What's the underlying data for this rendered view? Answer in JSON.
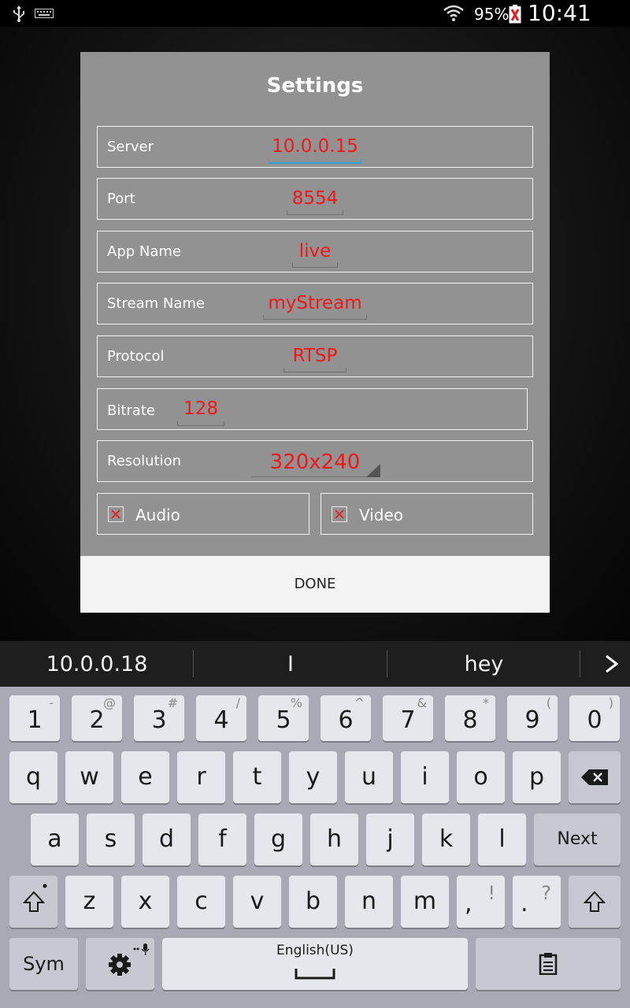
{
  "status_bar": {
    "battery": "95%",
    "time": "10:41 AM"
  },
  "dialog": {
    "title": "Settings",
    "fields": [
      {
        "label": "Server",
        "value": "10.0.0.15"
      },
      {
        "label": "Port",
        "value": "8554"
      },
      {
        "label": "App Name",
        "value": "live"
      },
      {
        "label": "Stream Name",
        "value": "myStream"
      },
      {
        "label": "Protocol",
        "value": "RTSP"
      },
      {
        "label": "Bitrate",
        "value": "128"
      },
      {
        "label": "Resolution",
        "value": "320x240"
      }
    ],
    "checkboxes": [
      {
        "label": "Audio",
        "checked": true
      },
      {
        "label": "Video",
        "checked": true
      }
    ],
    "done_label": "DONE"
  },
  "suggestions": [
    "10.0.0.18",
    "I",
    "hey"
  ],
  "keyboard": {
    "number_row": [
      {
        "key": "1",
        "sup": "-"
      },
      {
        "key": "2",
        "sup": "@"
      },
      {
        "key": "3",
        "sup": "#"
      },
      {
        "key": "4",
        "sup": "/"
      },
      {
        "key": "5",
        "sup": "%"
      },
      {
        "key": "6",
        "sup": "^"
      },
      {
        "key": "7",
        "sup": "&"
      },
      {
        "key": "8",
        "sup": "*"
      },
      {
        "key": "9",
        "sup": "("
      },
      {
        "key": "0",
        "sup": ")"
      }
    ],
    "row1": [
      "q",
      "w",
      "e",
      "r",
      "t",
      "y",
      "u",
      "i",
      "o",
      "p"
    ],
    "row2": [
      "a",
      "s",
      "d",
      "f",
      "g",
      "h",
      "j",
      "k",
      "l"
    ],
    "row3": [
      "z",
      "x",
      "c",
      "v",
      "b",
      "n",
      "m"
    ],
    "comma": ",",
    "comma_sup": "!",
    "period": ".",
    "period_sup": "?",
    "next_label": "Next",
    "sym_label": "Sym",
    "space_label": "English(US)"
  }
}
